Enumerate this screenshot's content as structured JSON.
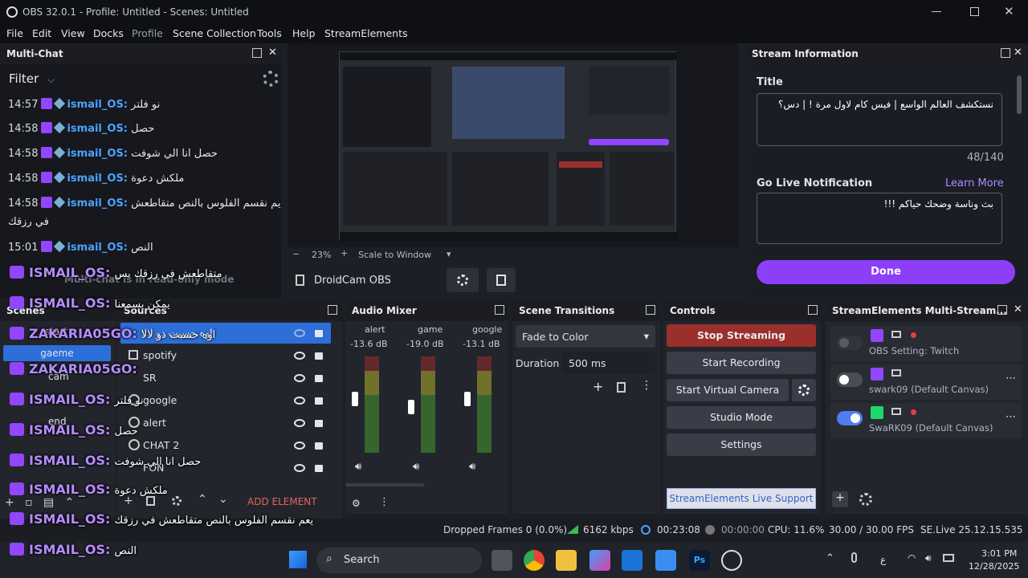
{
  "window": {
    "title": "OBS 32.0.1 - Profile: Untitled - Scenes: Untitled"
  },
  "menu": [
    "File",
    "Edit",
    "View",
    "Docks",
    "Profile",
    "Scene Collection",
    "Tools",
    "Help",
    "StreamElements"
  ],
  "multichat": {
    "title": "Multi-Chat",
    "filter_label": "Filter",
    "readonly_notice": "Multi-chat is in read-only mode",
    "messages": [
      {
        "time": "14:57",
        "user": "ismail_OS:",
        "text": "نو فلتر"
      },
      {
        "time": "14:58",
        "user": "ismail_OS:",
        "text": "حصل"
      },
      {
        "time": "14:58",
        "user": "ismail_OS:",
        "text": "حصل انا الي شوفت"
      },
      {
        "time": "14:58",
        "user": "ismail_OS:",
        "text": "ملكش دعوة"
      },
      {
        "time": "14:58",
        "user": "ismail_OS:",
        "text": "يم نقسم الفلوس بالنص متقاطعش"
      },
      {
        "time": "",
        "user": "",
        "text": "في رزقك"
      },
      {
        "time": "15:01",
        "user": "ismail_OS:",
        "text": "النص"
      }
    ]
  },
  "overlay_chat": [
    {
      "user": "ISMAIL_OS:",
      "text": "متقاطعش في رزقك بس"
    },
    {
      "user": "ISMAIL_OS:",
      "text": "يمكن يسمعنا"
    },
    {
      "user": "ZAKARIA05GO:",
      "text": "اوه حسبت دو لالا"
    },
    {
      "user": "ZAKARIA05GO:",
      "text": ""
    },
    {
      "user": "ISMAIL_OS:",
      "text": "نو فلتر"
    },
    {
      "user": "ISMAIL_OS:",
      "text": "حصل"
    },
    {
      "user": "ISMAIL_OS:",
      "text": "حصل انا الي شوفت"
    },
    {
      "user": "ISMAIL_OS:",
      "text": "ملكش دعوة"
    },
    {
      "user": "ISMAIL_OS:",
      "text": "يعم نقسم الفلوس بالنص متقاطعش في رزقك"
    },
    {
      "user": "ISMAIL_OS:",
      "text": "النص"
    }
  ],
  "preview": {
    "zoom": "23%",
    "scale_mode": "Scale to Window",
    "source_name": "DroidCam OBS"
  },
  "stream_info": {
    "title": "Stream Information",
    "title_label": "Title",
    "title_value": "نستكشف العالم الواسع | فيس كام لاول مرة ! | دس؟",
    "counter": "48/140",
    "golive_label": "Go Live Notification",
    "learn_more": "Learn More",
    "golive_value": "بث وناسة وضحك حياكم !!!",
    "done": "Done"
  },
  "scenes": {
    "title": "Scenes",
    "items": [
      "start",
      "gaeme",
      "cam",
      "",
      "end"
    ]
  },
  "sources": {
    "title": "Sources",
    "items": [
      "اوه حسبت دو لالا",
      "spotify",
      "SR",
      "google",
      "alert",
      "CHAT 2",
      "FON"
    ],
    "add_element": "ADD ELEMENT"
  },
  "audio_mixer": {
    "title": "Audio Mixer",
    "channels": [
      {
        "name": "alert",
        "db": "-13.6 dB"
      },
      {
        "name": "game",
        "db": "-19.0 dB"
      },
      {
        "name": "google",
        "db": "-13.1 dB"
      }
    ],
    "scale": [
      "0",
      "-5",
      "-10",
      "-15",
      "-20",
      "-25",
      "-30",
      "-35",
      "-40",
      "-45",
      "-50",
      "-55",
      "-60"
    ]
  },
  "transitions": {
    "title": "Scene Transitions",
    "selected": "Fade to Color",
    "duration_label": "Duration",
    "duration_value": "500 ms"
  },
  "controls": {
    "title": "Controls",
    "stop_streaming": "Stop Streaming",
    "start_recording": "Start Recording",
    "start_virtual_camera": "Start Virtual Camera",
    "studio_mode": "Studio Mode",
    "settings": "Settings",
    "support": "StreamElements Live Support"
  },
  "multistream": {
    "title": "StreamElements Multi-Stream...",
    "targets": [
      {
        "name": "OBS Setting: Twitch",
        "enabled": false,
        "live": true
      },
      {
        "name": "swark09 (Default Canvas)",
        "enabled": false,
        "live": false
      },
      {
        "name": "SwaRK09 (Default Canvas)",
        "enabled": true,
        "live": true
      }
    ]
  },
  "status": {
    "dropped": "Dropped Frames 0 (0.0%)",
    "kbps": "6162 kbps",
    "stream_time": "00:23:08",
    "rec_time": "00:00:00",
    "cpu": "CPU: 11.6%",
    "fps": "30.00 / 30.00 FPS",
    "version": "SE.Live 25.12.15.535"
  },
  "taskbar": {
    "search": "Search",
    "time": "3:01 PM",
    "date": "12/28/2025",
    "lang": "ع"
  },
  "colors": {
    "accent_purple": "#9146ff",
    "stop_red": "#9a2f2b",
    "link_blue": "#4aa3ff"
  }
}
